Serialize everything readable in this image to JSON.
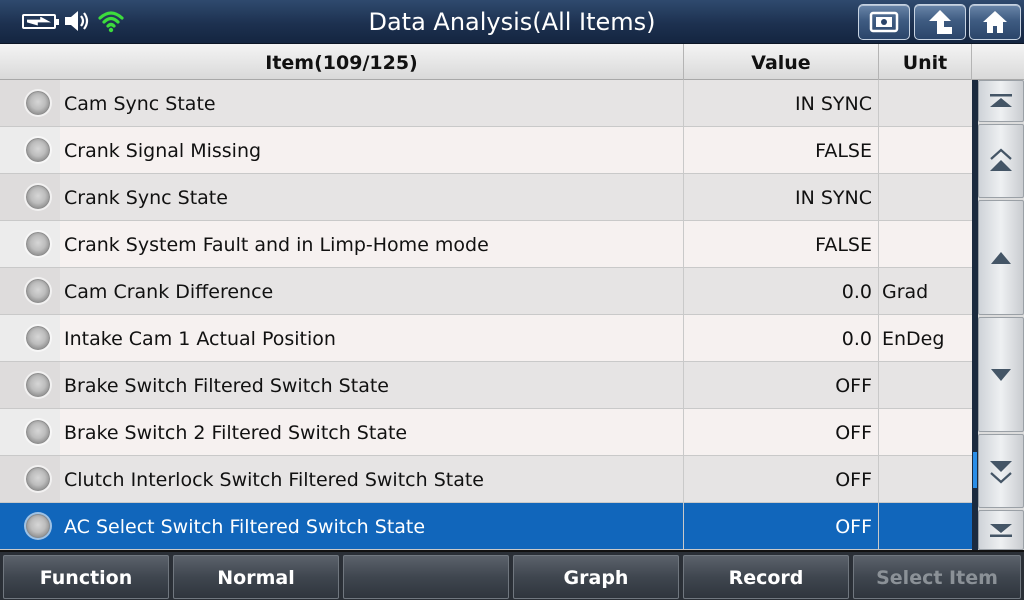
{
  "header": {
    "title": "Data Analysis(All Items)",
    "icons": [
      "battery-charging-icon",
      "speaker-icon",
      "wifi-icon"
    ],
    "buttons": [
      "screenshot-icon",
      "back-arrow-icon",
      "home-icon"
    ]
  },
  "table": {
    "columns": {
      "item": "Item(109/125)",
      "value": "Value",
      "unit": "Unit"
    },
    "rows": [
      {
        "item": "Cam Sync State",
        "value": "IN SYNC",
        "unit": ""
      },
      {
        "item": "Crank Signal Missing",
        "value": "FALSE",
        "unit": ""
      },
      {
        "item": "Crank Sync State",
        "value": "IN SYNC",
        "unit": ""
      },
      {
        "item": "Crank System Fault and in Limp-Home mode",
        "value": "FALSE",
        "unit": ""
      },
      {
        "item": "Cam Crank Difference",
        "value": "0.0",
        "unit": "Grad"
      },
      {
        "item": "Intake Cam 1 Actual Position",
        "value": "0.0",
        "unit": "EnDeg"
      },
      {
        "item": "Brake Switch Filtered Switch State",
        "value": "OFF",
        "unit": ""
      },
      {
        "item": "Brake Switch 2 Filtered Switch State",
        "value": "OFF",
        "unit": ""
      },
      {
        "item": "Clutch Interlock Switch Filtered Switch State",
        "value": "OFF",
        "unit": ""
      },
      {
        "item": "AC Select Switch Filtered Switch State",
        "value": "OFF",
        "unit": ""
      }
    ],
    "selected_row": 9
  },
  "scrollbar": {
    "buttons": [
      "scroll-top-icon",
      "page-up-icon",
      "scroll-up-icon",
      "scroll-down-icon",
      "page-down-icon",
      "scroll-bottom-icon"
    ]
  },
  "footer": {
    "buttons": [
      "Function",
      "Normal",
      "",
      "Graph",
      "Record",
      "Select Item"
    ],
    "disabled": [
      false,
      false,
      false,
      false,
      false,
      true
    ]
  },
  "colors": {
    "header_bg": "#1d3150",
    "selected_row": "#1166bb",
    "wifi": "#3ddc3d",
    "scroll_indicator": "#2a8ee8"
  }
}
